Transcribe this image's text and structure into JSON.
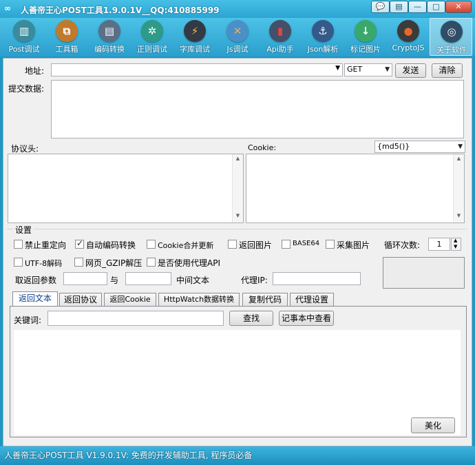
{
  "window": {
    "logo": "∞",
    "title": "人善帝王心POST工具1.9.0.1V__QQ:410885999",
    "controls": {
      "chat": "💬",
      "menu": "▤",
      "minimize": "—",
      "maximize": "□",
      "close": "✕"
    }
  },
  "toolbar": [
    {
      "label": "Post调试",
      "icon": "bars-chart-icon",
      "glyph": "▥",
      "color": "#3a8b9c"
    },
    {
      "label": "工具箱",
      "icon": "toolbox-icon",
      "glyph": "⧉",
      "color": "#c07a2c"
    },
    {
      "label": "编码转换",
      "icon": "window-icon",
      "glyph": "▤",
      "color": "#5b6f86"
    },
    {
      "label": "正则调试",
      "icon": "gear-icon",
      "glyph": "✲",
      "color": "#2e9a87"
    },
    {
      "label": "字库调试",
      "icon": "lightning-icon",
      "glyph": "⚡",
      "color": "#333a45"
    },
    {
      "label": "Js调试",
      "icon": "tools-icon",
      "glyph": "✕",
      "color": "#4b8fc9"
    },
    {
      "label": "Api助手",
      "icon": "book-icon",
      "glyph": "▮",
      "color": "#44506a"
    },
    {
      "label": "Json解析",
      "icon": "anchor-icon",
      "glyph": "⚓",
      "color": "#355a8a"
    },
    {
      "label": "标记图片",
      "icon": "download-icon",
      "glyph": "↓",
      "color": "#3aa86a"
    },
    {
      "label": "CryptoJS",
      "icon": "bomb-icon",
      "glyph": "●",
      "color": "#3b3b3b"
    },
    {
      "label": "关于软件",
      "icon": "aperture-icon",
      "glyph": "◎",
      "color": "#2f4d66"
    }
  ],
  "request": {
    "address_label": "地址:",
    "address_value": "",
    "method": "GET",
    "send_button": "发送",
    "clear_button": "清除",
    "post_data_label": "提交数据:",
    "headers_label": "协议头:",
    "cookie_label": "Cookie:",
    "cookie_func": "{md5()}"
  },
  "settings": {
    "group_label": "设置",
    "checkboxes": [
      {
        "label": "禁止重定向",
        "checked": false
      },
      {
        "label": "自动编码转换",
        "checked": true
      },
      {
        "label": "Cookie合并更新",
        "checked": false
      },
      {
        "label": "返回图片",
        "checked": false
      },
      {
        "label": "BASE64",
        "checked": false
      },
      {
        "label": "采集图片",
        "checked": false
      },
      {
        "label": "UTF-8解码",
        "checked": false
      },
      {
        "label": "网页_GZIP解压",
        "checked": false
      },
      {
        "label": "是否使用代理API",
        "checked": false
      }
    ],
    "loop_label": "循环次数:",
    "loop_value": "1",
    "extract_label": "取返回参数",
    "and_label": "与",
    "middle_label": "中间文本",
    "proxy_label": "代理IP:",
    "proxy_value": ""
  },
  "tabs": [
    "返回文本",
    "返回协议",
    "返回Cookie",
    "HttpWatch数据转换",
    "复制代码",
    "代理设置"
  ],
  "result": {
    "keyword_label": "关键词:",
    "keyword_value": "",
    "find_button": "查找",
    "notepad_button": "记事本中查看",
    "beautify_button": "美化"
  },
  "status": "人善帝王心POST工具 V1.9.0.1V: 免费的开发辅助工具, 程序员必备"
}
